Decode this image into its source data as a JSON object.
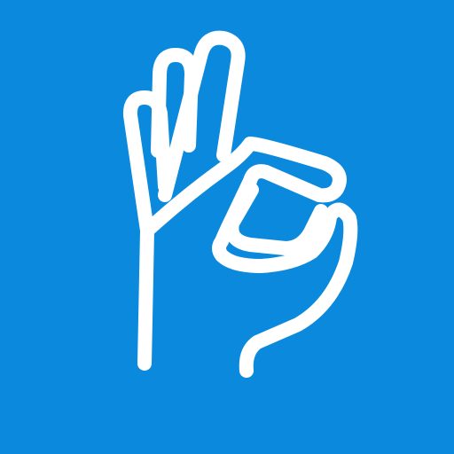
{
  "app_icon": {
    "background_color": "#0b89dd",
    "glyph_color": "#ffffff",
    "icon": "ok-hand-sign-icon"
  }
}
